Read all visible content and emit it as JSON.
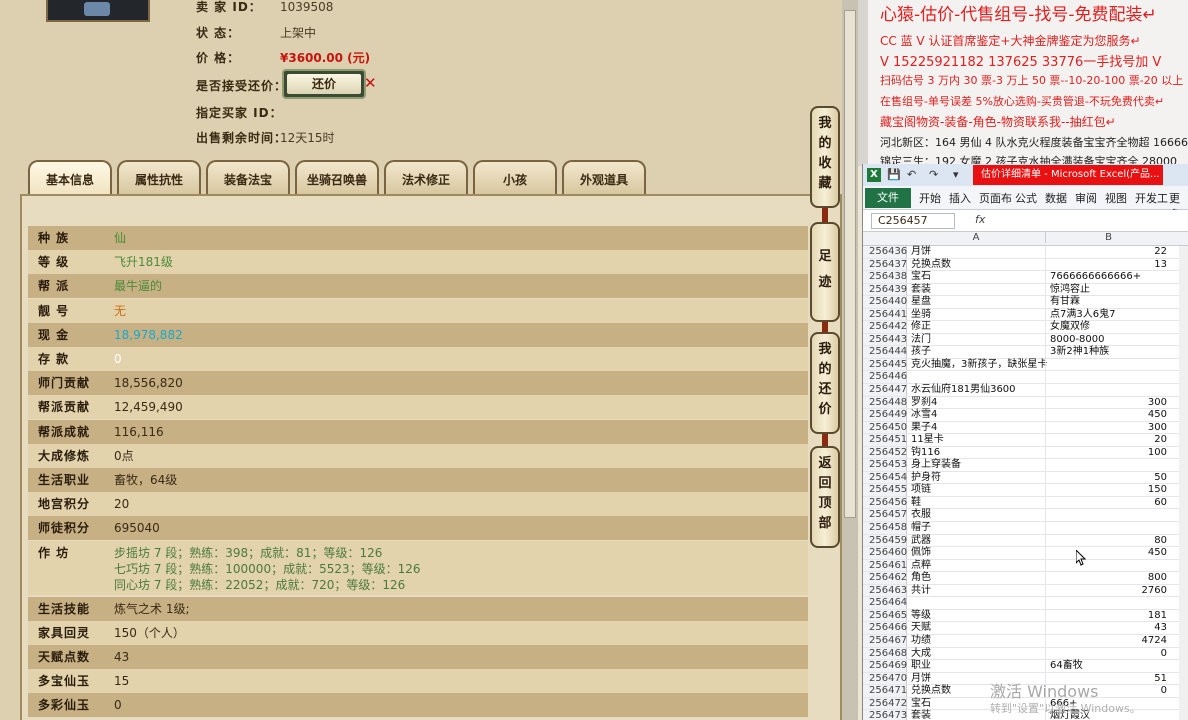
{
  "item": {
    "seller_label": "卖 家 ID：",
    "seller_id": "1039508",
    "status_label": "状 态：",
    "status": "上架中",
    "price_label": "价 格：",
    "price": "¥3600.00 (元)",
    "haggle_label": "是否接受还价：",
    "haggle_button": "还价",
    "buyer_label": "指定买家 ID：",
    "time_label": "出售剩余时间：",
    "time_left": "12天15时"
  },
  "tabs": [
    "基本信息",
    "属性抗性",
    "装备法宝",
    "坐骑召唤兽",
    "法术修正",
    "小孩",
    "外观道具"
  ],
  "attributes": [
    {
      "k": "种 族",
      "v": "仙",
      "color": "green"
    },
    {
      "k": "等 级",
      "v": "飞升181级",
      "color": "green"
    },
    {
      "k": "帮 派",
      "v": "最牛逼的",
      "color": "green"
    },
    {
      "k": "靓 号",
      "v": "无",
      "color": "orange"
    },
    {
      "k": "现 金",
      "v": "18,978,882",
      "color": "cyan"
    },
    {
      "k": "存 款",
      "v": "0",
      "color": "white"
    },
    {
      "k": "师门贡献",
      "v": "18,556,820",
      "color": "dark"
    },
    {
      "k": "帮派贡献",
      "v": "12,459,490",
      "color": "dark"
    },
    {
      "k": "帮派成就",
      "v": "116,116",
      "color": "dark"
    },
    {
      "k": "大成修炼",
      "v": "0点",
      "color": "dark"
    },
    {
      "k": "生活职业",
      "v": "畜牧，64级",
      "color": "dark"
    },
    {
      "k": "地宫积分",
      "v": "20",
      "color": "dark"
    },
    {
      "k": "师徒积分",
      "v": "695040",
      "color": "dark"
    }
  ],
  "workshop": {
    "k": "作 坊",
    "lines": [
      "步摇坊 7 段；熟练：398；成就：81；等级：126",
      "七巧坊 7 段；熟练：100000；成就：5523；等级：126",
      "同心坊 7 段；熟练：22052；成就：720；等级：126"
    ]
  },
  "attributes2": [
    {
      "k": "生活技能",
      "v": "炼气之术 1级;",
      "color": "dark"
    },
    {
      "k": "家具回灵",
      "v": "150（个人）",
      "color": "dark"
    },
    {
      "k": "天赋点数",
      "v": "43",
      "color": "dark"
    },
    {
      "k": "多宝仙玉",
      "v": "15",
      "color": "dark"
    },
    {
      "k": "多彩仙玉",
      "v": "0",
      "color": "dark"
    }
  ],
  "side_buttons": [
    "我的收藏",
    "足迹",
    "我的还价",
    "返回顶部"
  ],
  "ads": {
    "title": "心猿-估价-代售组号-找号-免费配装↵",
    "l2": "CC 蓝 V 认证首席鉴定+大神金牌鉴定为您服务↵",
    "l3": "V 15225921182    137625 33776一手找号加 V",
    "l4": "扫码估号 3 万内 30 票-3 万上 50 票--10-20-100 票-20 以上 150",
    "l5": "在售组号-单号误差 5%放心选购-买贵管退-不玩免费代卖↵",
    "l6": "藏宝阁物资-装备-角色-物资联系我--抽红包↵",
    "l7": "河北新区：164 男仙 4 队水克火程度装备宝宝齐全物超 16666",
    "l8": "锦定三生：192 女魔 2 孩子克水抽全满装备宝宝齐全 28000"
  },
  "excel": {
    "doc_title": "估价详细清单 - Microsoft Excel(产品...",
    "ribbon_file": "文件",
    "ribbon_tabs": [
      "开始",
      "插入",
      "页面布",
      "公式",
      "数据",
      "审阅",
      "视图",
      "开发工",
      "更多"
    ],
    "namebox": "C256457",
    "fx": "fx",
    "col_a": "A",
    "col_b": "B",
    "rows": [
      {
        "n": "256436",
        "a": "月饼",
        "b": "22",
        "num": true
      },
      {
        "n": "256437",
        "a": "兑换点数",
        "b": "13",
        "num": true
      },
      {
        "n": "256438",
        "a": "宝石",
        "b": "7666666666666+",
        "num": false
      },
      {
        "n": "256439",
        "a": "套装",
        "b": "惊鸿容止",
        "num": false
      },
      {
        "n": "256440",
        "a": "星盘",
        "b": "有甘霖",
        "num": false
      },
      {
        "n": "256441",
        "a": "坐骑",
        "b": "点7满3人6鬼7",
        "num": false
      },
      {
        "n": "256442",
        "a": "修正",
        "b": "女魔双修",
        "num": false
      },
      {
        "n": "256443",
        "a": "法门",
        "b": "8000-8000",
        "num": false
      },
      {
        "n": "256444",
        "a": "孩子",
        "b": "3新2神1种族",
        "num": false
      },
      {
        "n": "256445",
        "a": "克火抽魔，3新孩子，缺张星卡",
        "b": "",
        "num": false
      },
      {
        "n": "256446",
        "a": "",
        "b": "",
        "num": false
      },
      {
        "n": "256447",
        "a": "水云仙府181男仙3600",
        "b": "",
        "num": false
      },
      {
        "n": "256448",
        "a": "罗刹4",
        "b": "300",
        "num": true
      },
      {
        "n": "256449",
        "a": "冰雪4",
        "b": "450",
        "num": true
      },
      {
        "n": "256450",
        "a": "果子4",
        "b": "300",
        "num": true
      },
      {
        "n": "256451",
        "a": "11星卡",
        "b": "20",
        "num": true
      },
      {
        "n": "256452",
        "a": "钩116",
        "b": "100",
        "num": true
      },
      {
        "n": "256453",
        "a": "身上穿装备",
        "b": "",
        "num": false
      },
      {
        "n": "256454",
        "a": "护身符",
        "b": "50",
        "num": true
      },
      {
        "n": "256455",
        "a": "项链",
        "b": "150",
        "num": true
      },
      {
        "n": "256456",
        "a": "鞋",
        "b": "60",
        "num": true
      },
      {
        "n": "256457",
        "a": "衣服",
        "b": "",
        "num": false
      },
      {
        "n": "256458",
        "a": "帽子",
        "b": "",
        "num": false
      },
      {
        "n": "256459",
        "a": "武器",
        "b": "80",
        "num": true
      },
      {
        "n": "256460",
        "a": "佩饰",
        "b": "450",
        "num": true
      },
      {
        "n": "256461",
        "a": "点粹",
        "b": "",
        "num": false
      },
      {
        "n": "256462",
        "a": "角色",
        "b": "800",
        "num": true
      },
      {
        "n": "256463",
        "a": "共计",
        "b": "2760",
        "num": true
      },
      {
        "n": "256464",
        "a": "",
        "b": "",
        "num": false
      },
      {
        "n": "256465",
        "a": "等级",
        "b": "181",
        "num": true
      },
      {
        "n": "256466",
        "a": "天赋",
        "b": "43",
        "num": true
      },
      {
        "n": "256467",
        "a": "功绩",
        "b": "4724",
        "num": true
      },
      {
        "n": "256468",
        "a": "大成",
        "b": "0",
        "num": true
      },
      {
        "n": "256469",
        "a": "职业",
        "b": "64畜牧",
        "num": false
      },
      {
        "n": "256470",
        "a": "月饼",
        "b": "51",
        "num": true
      },
      {
        "n": "256471",
        "a": "兑换点数",
        "b": "0",
        "num": true
      },
      {
        "n": "256472",
        "a": "宝石",
        "b": "666+",
        "num": false
      },
      {
        "n": "256473",
        "a": "套装",
        "b": "烟灯霞汉",
        "num": false
      }
    ]
  },
  "watermark": {
    "line1": "激活 Windows",
    "line2": "转到\"设置\"以激活 Windows。"
  },
  "colors": {
    "price_red": "#c8140a",
    "excel_green": "#217346",
    "ad_red": "#e02020"
  }
}
